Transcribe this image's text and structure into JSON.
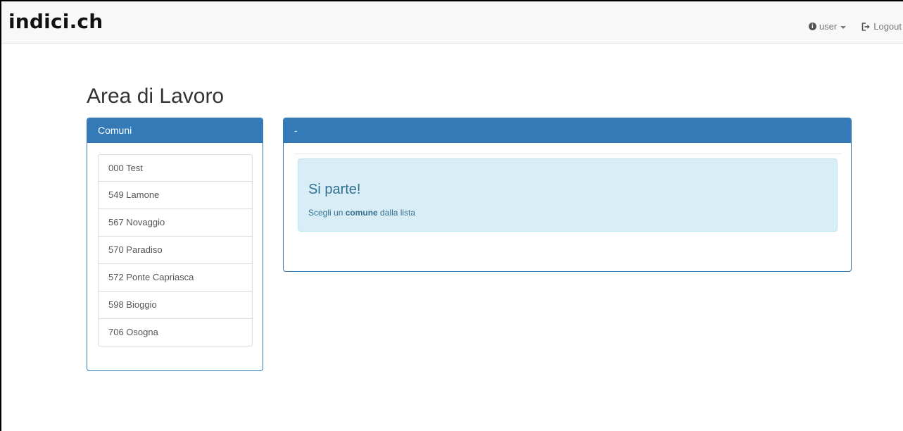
{
  "navbar": {
    "brand": "indici.ch",
    "user_label": "user",
    "logout_label": "Logout"
  },
  "page": {
    "title": "Area di Lavoro"
  },
  "comuni_panel": {
    "heading": "Comuni",
    "items": [
      {
        "label": "000 Test"
      },
      {
        "label": "549 Lamone"
      },
      {
        "label": "567 Novaggio"
      },
      {
        "label": "570 Paradiso"
      },
      {
        "label": "572 Ponte Capriasca"
      },
      {
        "label": "598 Bioggio"
      },
      {
        "label": "706 Osogna"
      }
    ]
  },
  "main_panel": {
    "heading": "-",
    "alert": {
      "title": "Si parte!",
      "text_before": "Scegli un ",
      "text_bold": "comune",
      "text_after": " dalla lista"
    }
  },
  "colors": {
    "primary": "#337ab7",
    "alert_bg": "#d9edf7",
    "alert_text": "#31708f"
  },
  "icons": {
    "user": "info-circle-icon",
    "logout": "logout-icon"
  }
}
